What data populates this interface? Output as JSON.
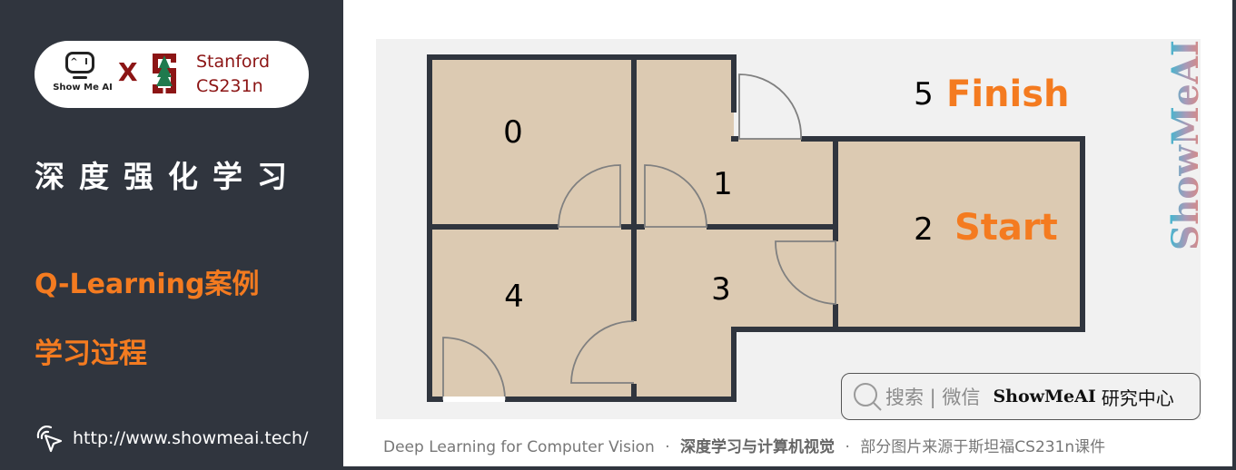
{
  "sidebar": {
    "logo": {
      "showmeai_text": "Show Me AI",
      "showmeai_eyes": "^ I",
      "cross": "X",
      "stanford_line1": "Stanford",
      "stanford_line2": "CS231n"
    },
    "course_title": "深度强化学习",
    "section_title": "Q-Learning案例",
    "section_subtitle": "学习过程",
    "url": "http://www.showmeai.tech/"
  },
  "diagram": {
    "rooms": [
      {
        "id": "0",
        "label": "0"
      },
      {
        "id": "1",
        "label": "1"
      },
      {
        "id": "2",
        "label": "2",
        "tag": "Start"
      },
      {
        "id": "3",
        "label": "3"
      },
      {
        "id": "4",
        "label": "4"
      },
      {
        "id": "5",
        "label": "5",
        "tag": "Finish"
      }
    ],
    "colors": {
      "floor": "#dccab2",
      "wall": "#30353e",
      "door": "#808080",
      "tag": "#f47b20",
      "outside": "#f1f1f1"
    }
  },
  "watermark": "ShowMeAI",
  "search_box": {
    "hint": "搜索 | 微信",
    "brand": "ShowMeAI",
    "center": "研究中心"
  },
  "footer": {
    "part1": "Deep Learning for Computer Vision",
    "sep": "·",
    "part2": "深度学习与计算机视觉",
    "part3": "部分图片来源于斯坦福CS231n课件"
  }
}
